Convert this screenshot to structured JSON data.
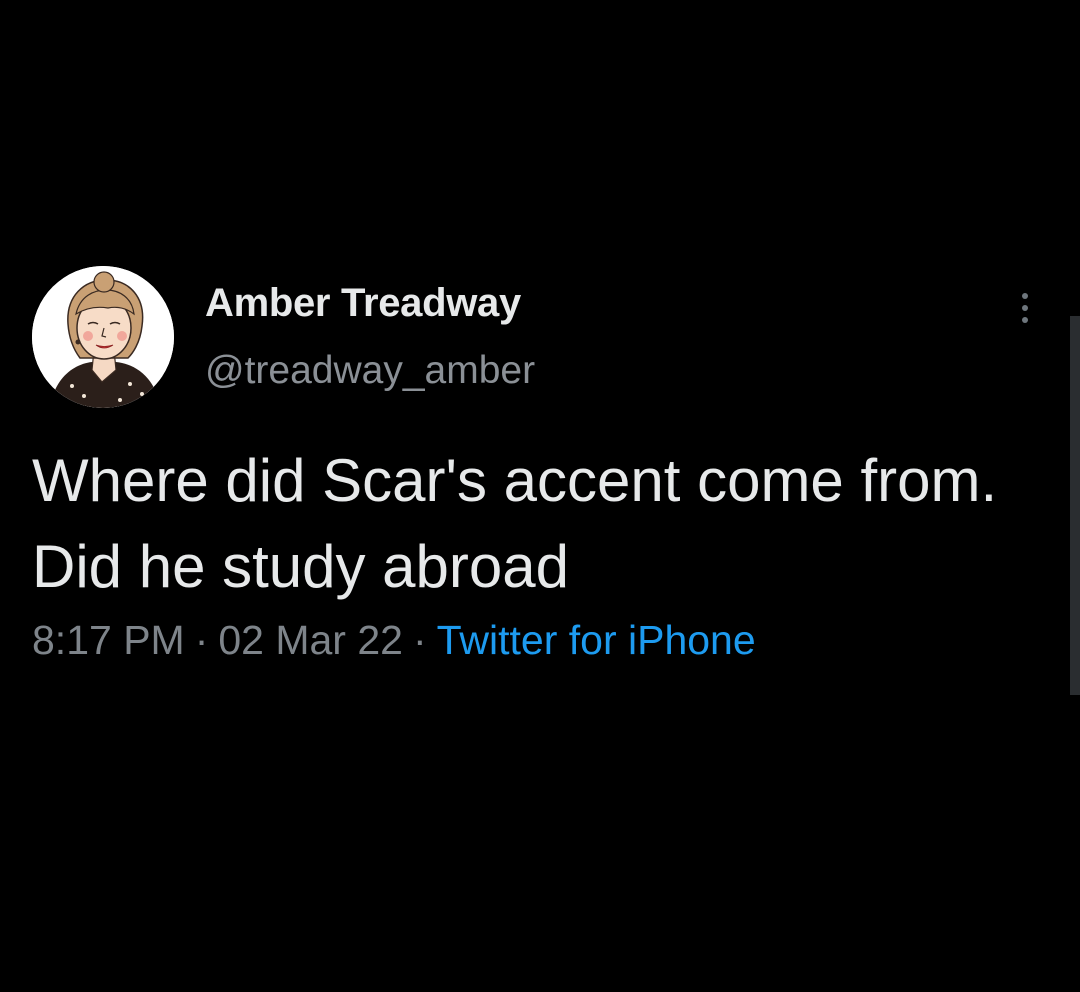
{
  "tweet": {
    "display_name": "Amber Treadway",
    "handle": "@treadway_amber",
    "text": "Where did Scar's accent come from. Did he study abroad",
    "time": "8:17 PM",
    "separator": "·",
    "date": "02 Mar 22",
    "source": "Twitter for iPhone"
  },
  "icons": {
    "avatar": "illustrated-portrait-avatar",
    "more": "more-options-vertical-dots-icon"
  },
  "colors": {
    "background": "#000000",
    "primary_text": "#e7e9ea",
    "secondary_text": "#8b9096",
    "link_accent": "#1d9bf0"
  }
}
